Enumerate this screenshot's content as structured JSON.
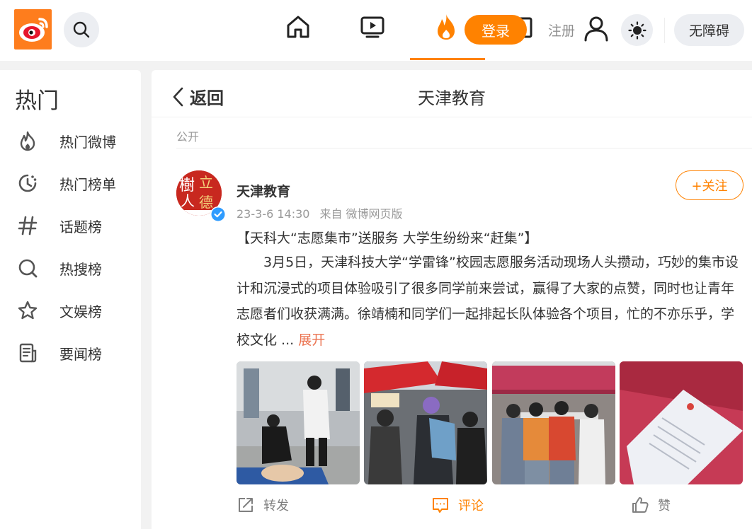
{
  "header": {
    "login_label": "登录",
    "register_label": "注册",
    "accessibility_label": "无障碍",
    "accent_color": "#ff8200"
  },
  "sidebar": {
    "title": "热门",
    "items": [
      {
        "label": "热门微博",
        "icon": "flame-outline-icon"
      },
      {
        "label": "热门榜单",
        "icon": "clock-icon"
      },
      {
        "label": "话题榜",
        "icon": "hashtag-icon"
      },
      {
        "label": "热搜榜",
        "icon": "search-list-icon"
      },
      {
        "label": "文娱榜",
        "icon": "star-icon"
      },
      {
        "label": "要闻榜",
        "icon": "news-icon"
      }
    ]
  },
  "main": {
    "back_label": "返回",
    "title": "天津教育",
    "visibility": "公开",
    "post": {
      "author": "天津教育",
      "time": "23-3-6 14:30",
      "source": "来自 微博网页版",
      "follow_label": "+关注",
      "headline": "【天科大“志愿集市”送服务 大学生纷纷来“赶集”】",
      "body": "3月5日，天津科技大学“学雷锋”校园志愿服务活动现场人头攒动，巧妙的集市设计和沉浸式的项目体验吸引了很多同学前来尝试，赢得了大家的点赞，同时也让青年志愿者们收获满满。徐靖楠和同学们一起排起长队体验各个项目，忙的不亦乐乎，学校文化 ...",
      "expand_label": "展开",
      "actions": {
        "share": "转发",
        "comment": "评论",
        "like": "赞"
      }
    }
  }
}
